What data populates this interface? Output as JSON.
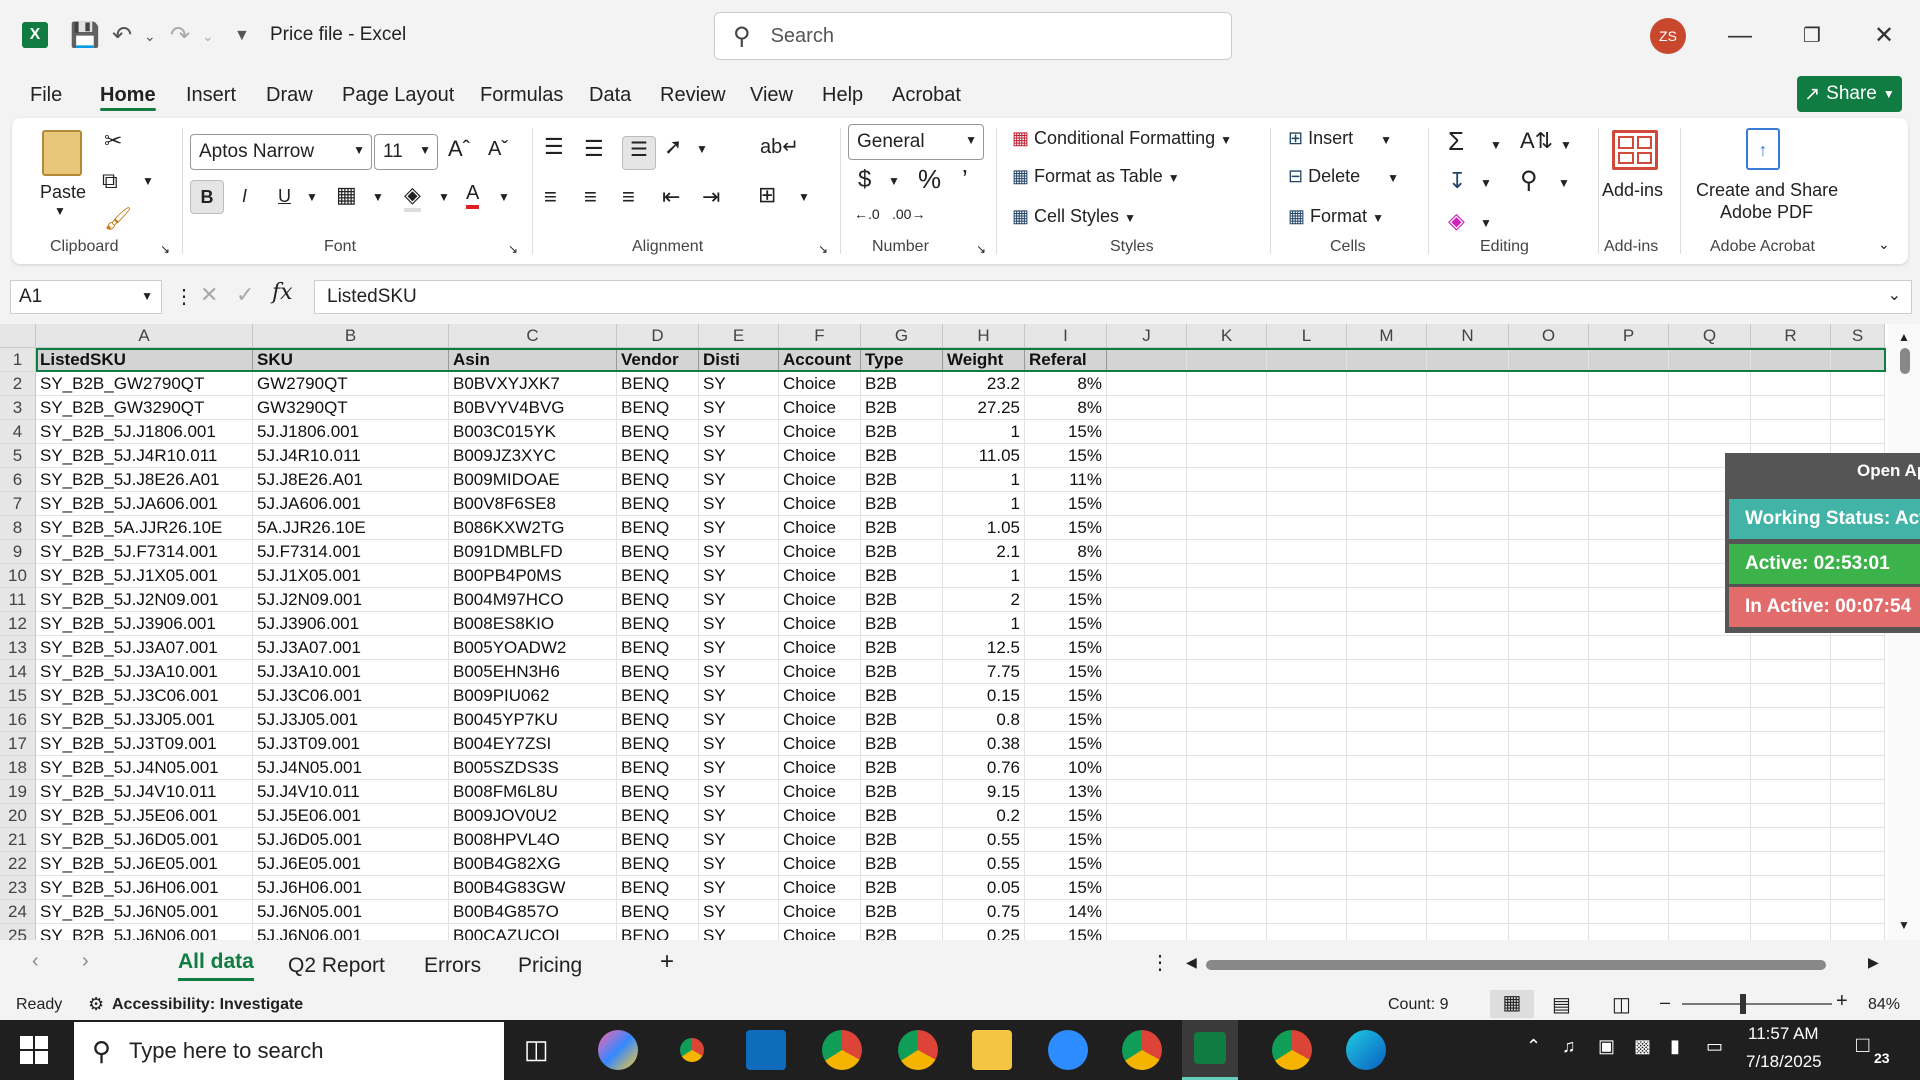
{
  "titlebar": {
    "doc_title": "Price file  -  Excel",
    "search_placeholder": "Search",
    "avatar_initials": "ZS"
  },
  "menu": {
    "tabs": [
      "File",
      "Home",
      "Insert",
      "Draw",
      "Page Layout",
      "Formulas",
      "Data",
      "Review",
      "View",
      "Help",
      "Acrobat"
    ],
    "active": "Home",
    "share_label": "Share"
  },
  "ribbon": {
    "paste_label": "Paste",
    "font_name": "Aptos Narrow",
    "font_size": "11",
    "number_format": "General",
    "conditional_formatting": "Conditional Formatting",
    "format_as_table": "Format as Table",
    "cell_styles": "Cell Styles",
    "insert": "Insert",
    "delete": "Delete",
    "format": "Format",
    "addins": "Add-ins",
    "create_share_pdf_1": "Create and Share",
    "create_share_pdf_2": "Adobe PDF",
    "groups": {
      "clipboard": "Clipboard",
      "font": "Font",
      "alignment": "Alignment",
      "number": "Number",
      "styles": "Styles",
      "cells": "Cells",
      "editing": "Editing",
      "addins": "Add-ins",
      "acrobat": "Adobe Acrobat"
    }
  },
  "formula_bar": {
    "name_box": "A1",
    "content": "ListedSKU"
  },
  "grid": {
    "columns": [
      "A",
      "B",
      "C",
      "D",
      "E",
      "F",
      "G",
      "H",
      "I",
      "J",
      "K",
      "L",
      "M",
      "N",
      "O",
      "P",
      "Q",
      "R",
      "S"
    ],
    "headers": [
      "ListedSKU",
      "SKU",
      "Asin",
      "Vendor",
      "Disti",
      "Account",
      "Type",
      "Weight",
      "Referal"
    ],
    "rows": [
      [
        "SY_B2B_GW2790QT",
        "GW2790QT",
        "B0BVXYJXK7",
        "BENQ",
        "SY",
        "Choice",
        "B2B",
        "23.2",
        "8%"
      ],
      [
        "SY_B2B_GW3290QT",
        "GW3290QT",
        "B0BVYV4BVG",
        "BENQ",
        "SY",
        "Choice",
        "B2B",
        "27.25",
        "8%"
      ],
      [
        "SY_B2B_5J.J1806.001",
        "5J.J1806.001",
        "B003C015YK",
        "BENQ",
        "SY",
        "Choice",
        "B2B",
        "1",
        "15%"
      ],
      [
        "SY_B2B_5J.J4R10.011",
        "5J.J4R10.011",
        "B009JZ3XYC",
        "BENQ",
        "SY",
        "Choice",
        "B2B",
        "11.05",
        "15%"
      ],
      [
        "SY_B2B_5J.J8E26.A01",
        "5J.J8E26.A01",
        "B009MIDOAE",
        "BENQ",
        "SY",
        "Choice",
        "B2B",
        "1",
        "11%"
      ],
      [
        "SY_B2B_5J.JA606.001",
        "5J.JA606.001",
        "B00V8F6SE8",
        "BENQ",
        "SY",
        "Choice",
        "B2B",
        "1",
        "15%"
      ],
      [
        "SY_B2B_5A.JJR26.10E",
        "5A.JJR26.10E",
        "B086KXW2TG",
        "BENQ",
        "SY",
        "Choice",
        "B2B",
        "1.05",
        "15%"
      ],
      [
        "SY_B2B_5J.F7314.001",
        "5J.F7314.001",
        "B091DMBLFD",
        "BENQ",
        "SY",
        "Choice",
        "B2B",
        "2.1",
        "8%"
      ],
      [
        "SY_B2B_5J.J1X05.001",
        "5J.J1X05.001",
        "B00PB4P0MS",
        "BENQ",
        "SY",
        "Choice",
        "B2B",
        "1",
        "15%"
      ],
      [
        "SY_B2B_5J.J2N09.001",
        "5J.J2N09.001",
        "B004M97HCO",
        "BENQ",
        "SY",
        "Choice",
        "B2B",
        "2",
        "15%"
      ],
      [
        "SY_B2B_5J.J3906.001",
        "5J.J3906.001",
        "B008ES8KIO",
        "BENQ",
        "SY",
        "Choice",
        "B2B",
        "1",
        "15%"
      ],
      [
        "SY_B2B_5J.J3A07.001",
        "5J.J3A07.001",
        "B005YOADW2",
        "BENQ",
        "SY",
        "Choice",
        "B2B",
        "12.5",
        "15%"
      ],
      [
        "SY_B2B_5J.J3A10.001",
        "5J.J3A10.001",
        "B005EHN3H6",
        "BENQ",
        "SY",
        "Choice",
        "B2B",
        "7.75",
        "15%"
      ],
      [
        "SY_B2B_5J.J3C06.001",
        "5J.J3C06.001",
        "B009PIU062",
        "BENQ",
        "SY",
        "Choice",
        "B2B",
        "0.15",
        "15%"
      ],
      [
        "SY_B2B_5J.J3J05.001",
        "5J.J3J05.001",
        "B0045YP7KU",
        "BENQ",
        "SY",
        "Choice",
        "B2B",
        "0.8",
        "15%"
      ],
      [
        "SY_B2B_5J.J3T09.001",
        "5J.J3T09.001",
        "B004EY7ZSI",
        "BENQ",
        "SY",
        "Choice",
        "B2B",
        "0.38",
        "15%"
      ],
      [
        "SY_B2B_5J.J4N05.001",
        "5J.J4N05.001",
        "B005SZDS3S",
        "BENQ",
        "SY",
        "Choice",
        "B2B",
        "0.76",
        "10%"
      ],
      [
        "SY_B2B_5J.J4V10.011",
        "5J.J4V10.011",
        "B008FM6L8U",
        "BENQ",
        "SY",
        "Choice",
        "B2B",
        "9.15",
        "13%"
      ],
      [
        "SY_B2B_5J.J5E06.001",
        "5J.J5E06.001",
        "B009JOV0U2",
        "BENQ",
        "SY",
        "Choice",
        "B2B",
        "0.2",
        "15%"
      ],
      [
        "SY_B2B_5J.J6D05.001",
        "5J.J6D05.001",
        "B008HPVL4O",
        "BENQ",
        "SY",
        "Choice",
        "B2B",
        "0.55",
        "15%"
      ],
      [
        "SY_B2B_5J.J6E05.001",
        "5J.J6E05.001",
        "B00B4G82XG",
        "BENQ",
        "SY",
        "Choice",
        "B2B",
        "0.55",
        "15%"
      ],
      [
        "SY_B2B_5J.J6H06.001",
        "5J.J6H06.001",
        "B00B4G83GW",
        "BENQ",
        "SY",
        "Choice",
        "B2B",
        "0.05",
        "15%"
      ],
      [
        "SY_B2B_5J.J6N05.001",
        "5J.J6N05.001",
        "B00B4G857O",
        "BENQ",
        "SY",
        "Choice",
        "B2B",
        "0.75",
        "14%"
      ],
      [
        "SY_B2B_5J.J6N06.001",
        "5J.J6N06.001",
        "B00CAZUCOI",
        "BENQ",
        "SY",
        "Choice",
        "B2B",
        "0.25",
        "15%"
      ]
    ]
  },
  "overlay": {
    "open_label": "Open Ap",
    "working_status": "Working Status: Acti",
    "active": "Active: 02:53:01",
    "inactive": "In Active: 00:07:54"
  },
  "sheets": {
    "tabs": [
      "All data",
      "Q2 Report",
      "Errors",
      "Pricing"
    ],
    "active": "All data"
  },
  "status": {
    "ready": "Ready",
    "accessibility": "Accessibility: Investigate",
    "count": "Count: 9",
    "zoom": "84%"
  },
  "taskbar": {
    "search_placeholder": "Type here to search",
    "time": "11:57 AM",
    "date": "7/18/2025",
    "notifications": "23"
  },
  "colors": {
    "excel_green": "#107c41",
    "status_teal": "#41b3a7",
    "active_green": "#3cb34a",
    "inactive_red": "#e26c6c"
  }
}
